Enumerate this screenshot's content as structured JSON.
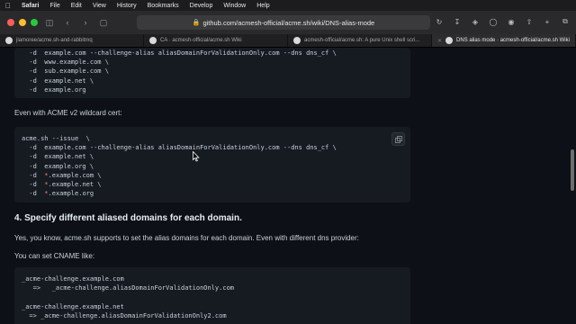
{
  "menubar": {
    "app": "Safari",
    "items": [
      "File",
      "Edit",
      "View",
      "History",
      "Bookmarks",
      "Develop",
      "Window",
      "Help"
    ]
  },
  "browser": {
    "url": "github.com/acmesh-official/acme.sh/wiki/DNS-alias-mode",
    "tabs": [
      {
        "label": "jlamoree/acme.sh-and-rabbitmq",
        "active": false
      },
      {
        "label": "CA · acmesh-official/acme.sh Wiki",
        "active": false
      },
      {
        "label": "acmesh-official/acme.sh: A pure Unix shell scri...",
        "active": false
      },
      {
        "label": "DNS alias mode · acmesh-official/acme.sh Wiki",
        "active": true
      }
    ]
  },
  "article": {
    "block1_lines": [
      "  -d  example.com --challenge-alias aliasDomainForValidationOnly.com --dns dns_cf \\",
      "  -d  www.example.com \\",
      "  -d  sub.example.com \\",
      "  -d  example.net \\",
      "  -d  example.org"
    ],
    "wildcard_text": "Even with ACME v2 wildcard cert:",
    "block2_lines": [
      "acme.sh --issue  \\",
      "  -d  example.com --challenge-alias aliasDomainForValidationOnly.com --dns dns_cf \\",
      "  -d  example.net \\",
      "  -d  example.org \\",
      "  -d  *.example.com \\",
      "  -d  *.example.net \\",
      "  -d  *.example.org"
    ],
    "heading": "4. Specify different aliased domains for each domain.",
    "para1": "Yes, you know, acme.sh supports to set the alias domains for each domain. Even with different dns provider:",
    "para2": "You can set CNAME like:",
    "block3_lines": [
      "_acme-challenge.example.com",
      "   =>   _acme-challenge.aliasDomainForValidationOnly.com",
      "",
      "_acme-challenge.example.net",
      "  => _acme-challenge.aliasDomainForValidationOnly2.com"
    ]
  },
  "colors": {
    "page_bg": "#0d1117",
    "code_bg": "#161b22",
    "wildcard_star": "#ff7b72"
  }
}
